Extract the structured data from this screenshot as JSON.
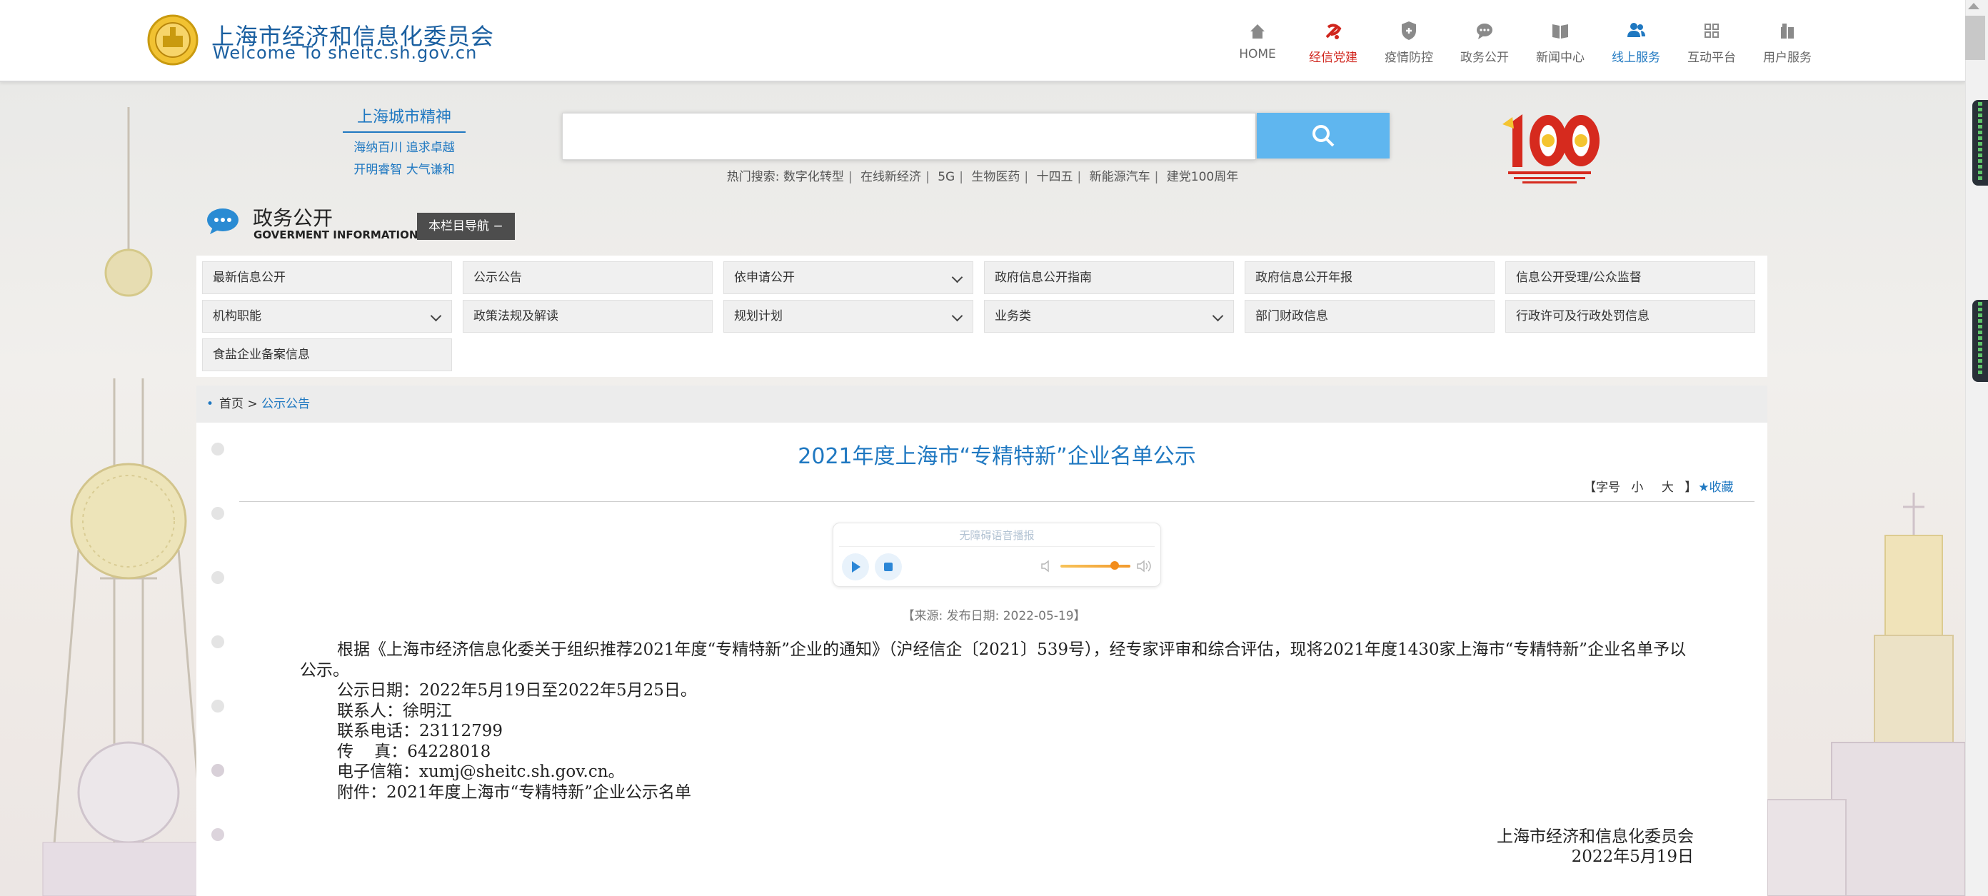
{
  "header": {
    "logo_cn": "上海市经济和信息化委员会",
    "logo_en": "Welcome To sheitc.sh.gov.cn",
    "nav": [
      {
        "label": "HOME",
        "icon": "home-icon"
      },
      {
        "label": "经信党建",
        "icon": "party-emblem-icon",
        "color": "#d0261e"
      },
      {
        "label": "疫情防控",
        "icon": "shield-icon"
      },
      {
        "label": "政务公开",
        "icon": "chat-icon"
      },
      {
        "label": "新闻中心",
        "icon": "book-icon"
      },
      {
        "label": "线上服务",
        "icon": "users-icon",
        "color": "#1f78c1"
      },
      {
        "label": "互动平台",
        "icon": "grid-icon"
      },
      {
        "label": "用户服务",
        "icon": "gift-icon"
      }
    ]
  },
  "spirit": {
    "title": "上海城市精神",
    "line1": "海纳百川  追求卓越",
    "line2": "开明睿智  大气谦和"
  },
  "search": {
    "placeholder": "",
    "hot_label": "热门搜索:",
    "hot_terms": [
      "数字化转型",
      "在线新经济",
      "5G",
      "生物医药",
      "十四五",
      "新能源汽车",
      "建党100周年"
    ]
  },
  "section": {
    "title": "政务公开",
    "subtitle": "GOVERMENT INFORMATION",
    "nav_label": "本栏目导航 −"
  },
  "menu": [
    {
      "label": "最新信息公开",
      "dropdown": false
    },
    {
      "label": "公示公告",
      "dropdown": false
    },
    {
      "label": "依申请公开",
      "dropdown": true
    },
    {
      "label": "政府信息公开指南",
      "dropdown": false
    },
    {
      "label": "政府信息公开年报",
      "dropdown": false
    },
    {
      "label": "信息公开受理/公众监督",
      "dropdown": false
    },
    {
      "label": "机构职能",
      "dropdown": true
    },
    {
      "label": "政策法规及解读",
      "dropdown": false
    },
    {
      "label": "规划计划",
      "dropdown": true
    },
    {
      "label": "业务类",
      "dropdown": true
    },
    {
      "label": "部门财政信息",
      "dropdown": false
    },
    {
      "label": "行政许可及行政处罚信息",
      "dropdown": false
    },
    {
      "label": "食盐企业备案信息",
      "dropdown": false
    }
  ],
  "breadcrumb": {
    "dot": "•",
    "home": "首页",
    "sep": ">",
    "current": "公示公告"
  },
  "article": {
    "title": "2021年度上海市“专精特新”企业名单公示",
    "font_prefix": "【字号",
    "font_small": "小",
    "font_large": "大",
    "font_suffix": "】",
    "favorite": "★收藏",
    "audio_label": "无障碍语音播报",
    "source": "【来源:   发布日期: 2022-05-19】",
    "paragraphs": [
      "根据《上海市经济信息化委关于组织推荐2021年度“专精特新”企业的通知》（沪经信企〔2021〕539号），经专家评审和综合评估，现将2021年度1430家上海市“专精特新”企业名单予以公示。",
      "公示日期：2022年5月19日至2022年5月25日。",
      "联系人：徐明江",
      "联系电话：23112799",
      "传    真：64228018",
      "电子信箱：xumj@sheitc.sh.gov.cn。",
      "附件：2021年度上海市“专精特新”企业公示名单"
    ],
    "signature_org": "上海市经济和信息化委员会",
    "signature_date": "2022年5月19日"
  }
}
